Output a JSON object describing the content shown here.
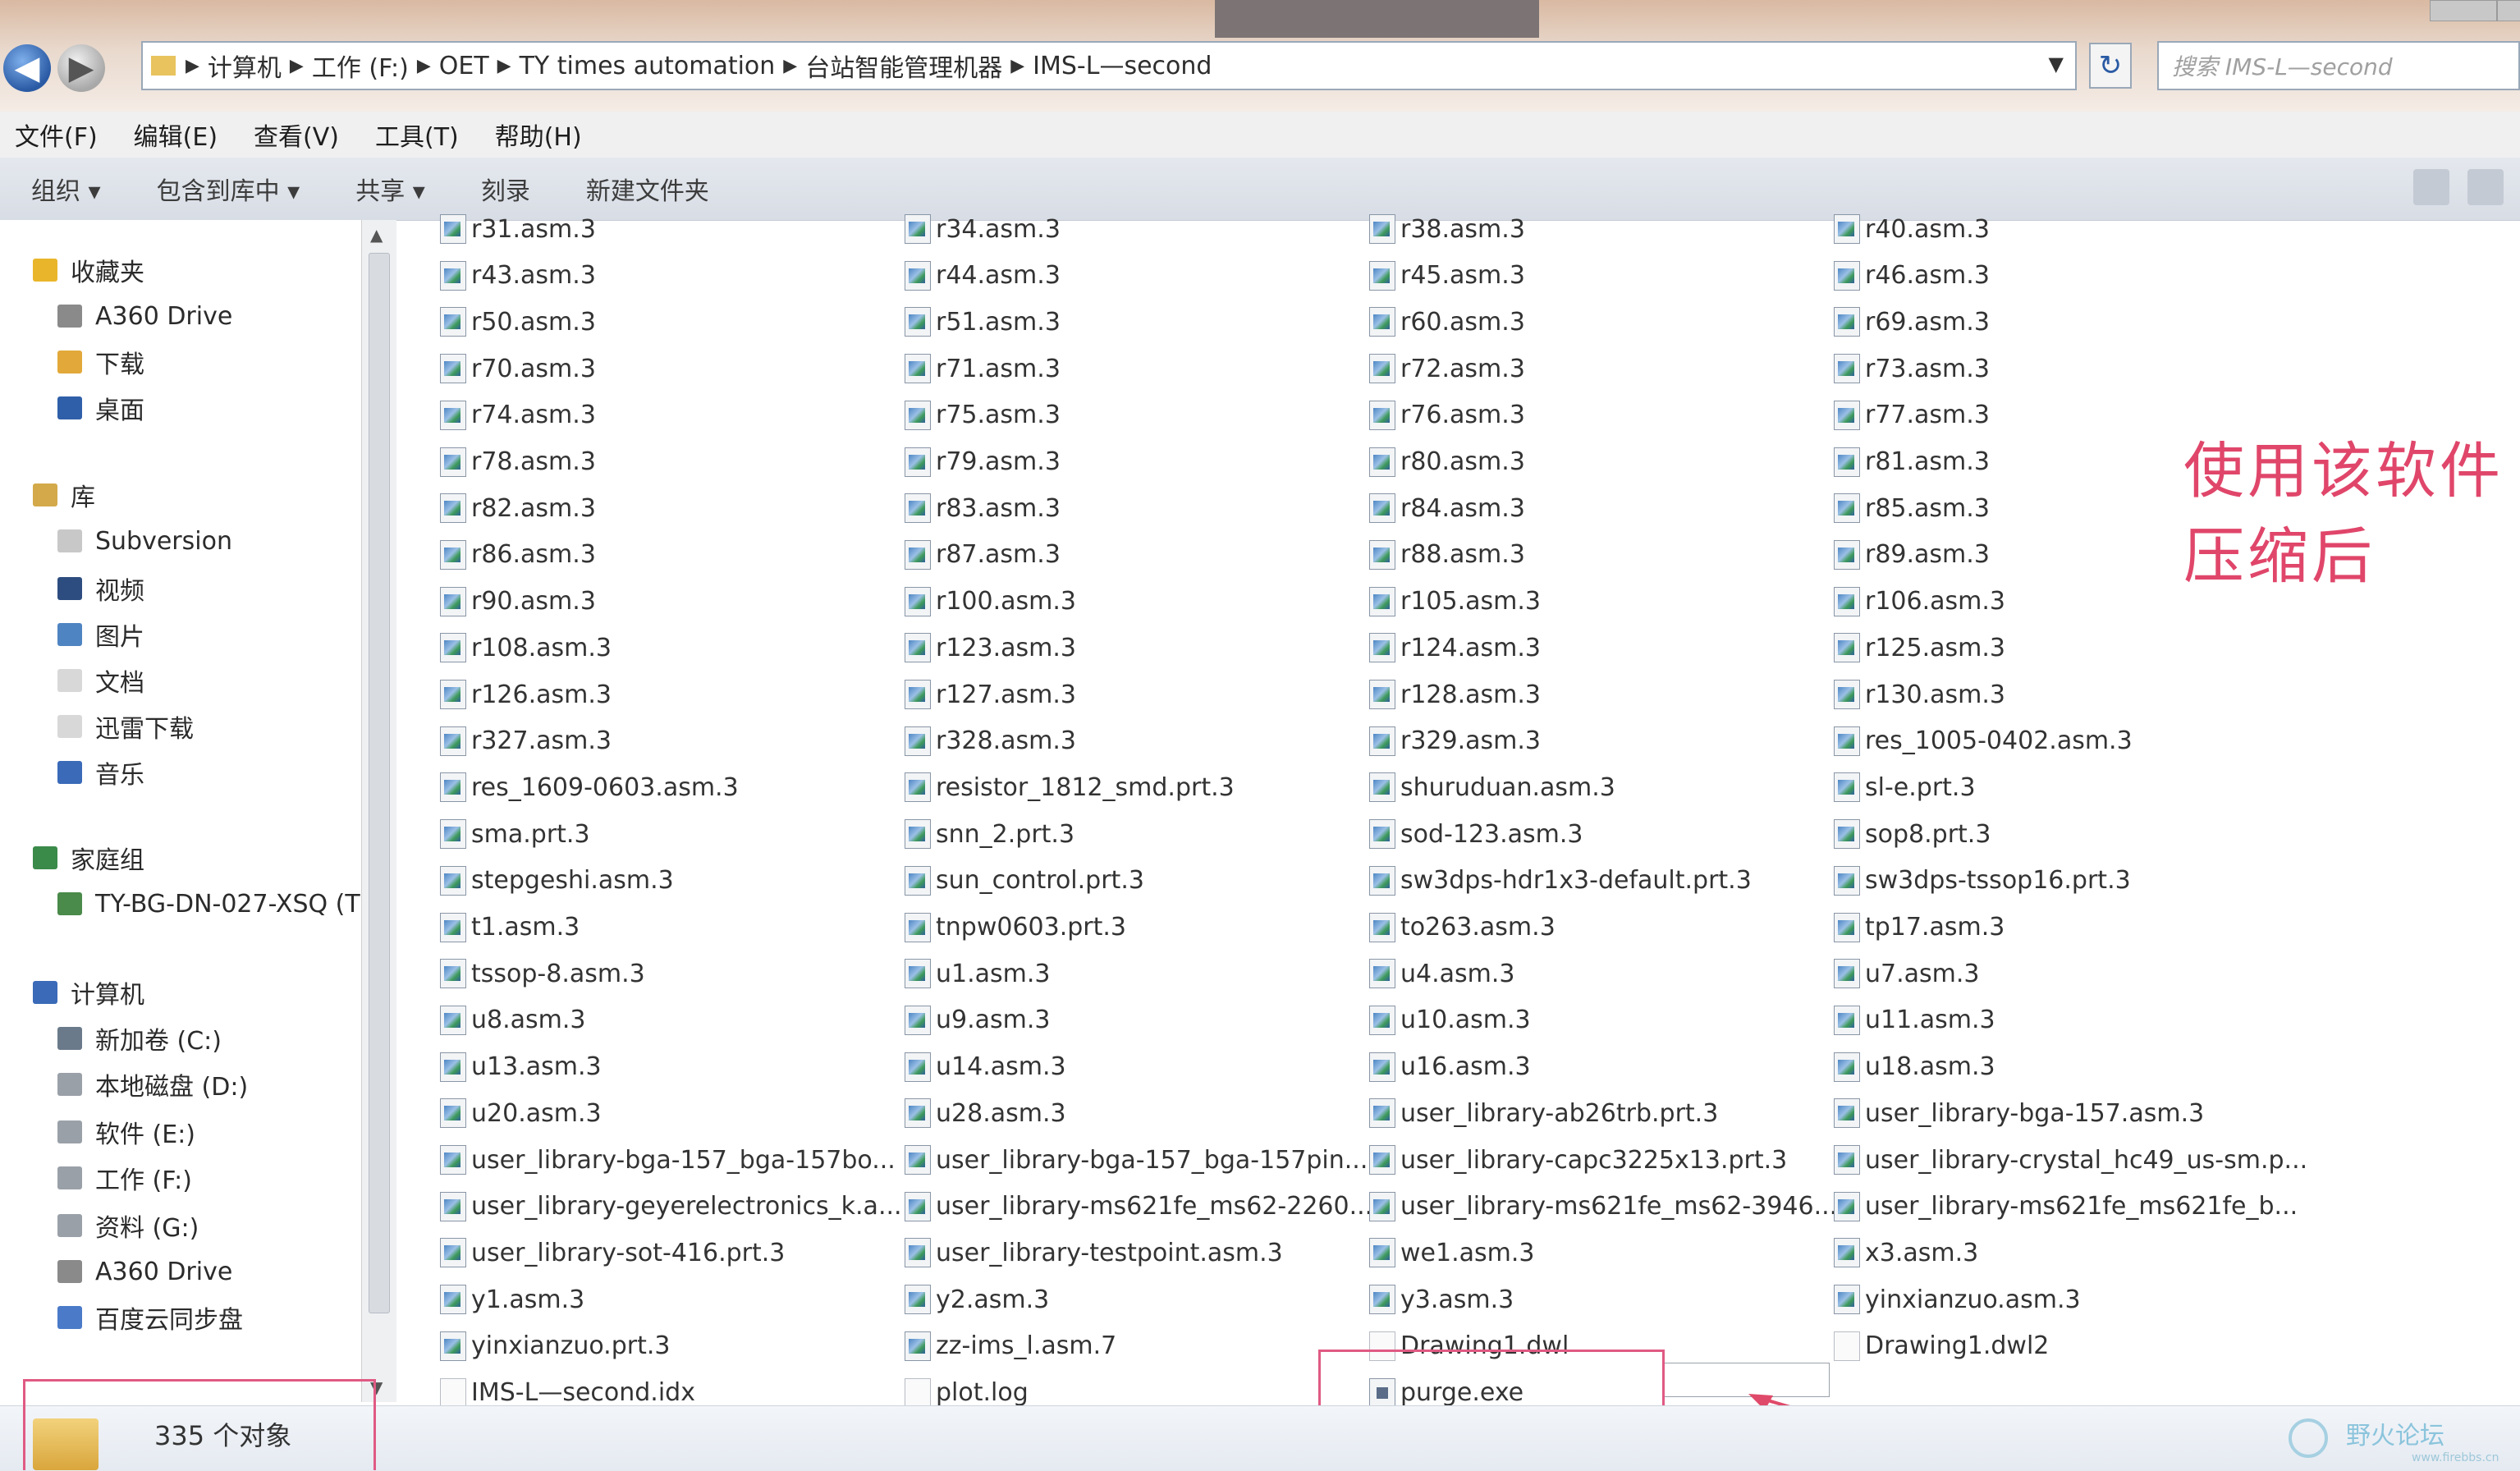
{
  "address": {
    "breadcrumbs": [
      "计算机",
      "工作 (F:)",
      "OET",
      "TY times automation",
      "台站智能管理机器",
      "IMS-L—second"
    ],
    "search_placeholder": "搜索 IMS-L—second"
  },
  "menu": [
    "文件(F)",
    "编辑(E)",
    "查看(V)",
    "工具(T)",
    "帮助(H)"
  ],
  "toolbar": [
    "组织 ▾",
    "包含到库中 ▾",
    "共享 ▾",
    "刻录",
    "新建文件夹"
  ],
  "sidebar": [
    {
      "label": "收藏夹",
      "icon": "star-icon",
      "color": "#e9b62b"
    },
    {
      "label": "A360 Drive",
      "icon": "cloud-drive-icon",
      "color": "#8a8a8a"
    },
    {
      "label": "下载",
      "icon": "download-folder-icon",
      "color": "#e2a93a"
    },
    {
      "label": "桌面",
      "icon": "desktop-icon",
      "color": "#2f5fa8"
    },
    {
      "label": "库",
      "icon": "library-icon",
      "color": "#d3a94a"
    },
    {
      "label": "Subversion",
      "icon": "folder-icon",
      "color": "#c8c8c8"
    },
    {
      "label": "视频",
      "icon": "video-icon",
      "color": "#2d4d80"
    },
    {
      "label": "图片",
      "icon": "pictures-icon",
      "color": "#4f84c2"
    },
    {
      "label": "文档",
      "icon": "documents-icon",
      "color": "#d8d8d8"
    },
    {
      "label": "迅雷下载",
      "icon": "folder-icon",
      "color": "#d8d8d8"
    },
    {
      "label": "音乐",
      "icon": "music-icon",
      "color": "#3a6ab8"
    },
    {
      "label": "家庭组",
      "icon": "homegroup-icon",
      "color": "#3a8a4a"
    },
    {
      "label": "TY-BG-DN-027-XSQ (T",
      "icon": "user-icon",
      "color": "#4a8a4a"
    },
    {
      "label": "计算机",
      "icon": "computer-icon",
      "color": "#3a6ab8"
    },
    {
      "label": "新加卷 (C:)",
      "icon": "drive-icon",
      "color": "#6a7a8a"
    },
    {
      "label": "本地磁盘 (D:)",
      "icon": "drive-icon",
      "color": "#9aa0a8"
    },
    {
      "label": "软件 (E:)",
      "icon": "drive-icon",
      "color": "#9aa0a8"
    },
    {
      "label": "工作 (F:)",
      "icon": "drive-icon",
      "color": "#9aa0a8"
    },
    {
      "label": "资料 (G:)",
      "icon": "drive-icon",
      "color": "#9aa0a8"
    },
    {
      "label": "A360 Drive",
      "icon": "cloud-drive-icon",
      "color": "#8a8a8a"
    },
    {
      "label": "百度云同步盘",
      "icon": "cloud-sync-icon",
      "color": "#4a7ac8"
    }
  ],
  "files": [
    [
      "r31.asm.3",
      "r34.asm.3",
      "r38.asm.3",
      "r40.asm.3"
    ],
    [
      "r43.asm.3",
      "r44.asm.3",
      "r45.asm.3",
      "r46.asm.3"
    ],
    [
      "r50.asm.3",
      "r51.asm.3",
      "r60.asm.3",
      "r69.asm.3"
    ],
    [
      "r70.asm.3",
      "r71.asm.3",
      "r72.asm.3",
      "r73.asm.3"
    ],
    [
      "r74.asm.3",
      "r75.asm.3",
      "r76.asm.3",
      "r77.asm.3"
    ],
    [
      "r78.asm.3",
      "r79.asm.3",
      "r80.asm.3",
      "r81.asm.3"
    ],
    [
      "r82.asm.3",
      "r83.asm.3",
      "r84.asm.3",
      "r85.asm.3"
    ],
    [
      "r86.asm.3",
      "r87.asm.3",
      "r88.asm.3",
      "r89.asm.3"
    ],
    [
      "r90.asm.3",
      "r100.asm.3",
      "r105.asm.3",
      "r106.asm.3"
    ],
    [
      "r108.asm.3",
      "r123.asm.3",
      "r124.asm.3",
      "r125.asm.3"
    ],
    [
      "r126.asm.3",
      "r127.asm.3",
      "r128.asm.3",
      "r130.asm.3"
    ],
    [
      "r327.asm.3",
      "r328.asm.3",
      "r329.asm.3",
      "res_1005-0402.asm.3"
    ],
    [
      "res_1609-0603.asm.3",
      "resistor_1812_smd.prt.3",
      "shuruduan.asm.3",
      "sl-e.prt.3"
    ],
    [
      "sma.prt.3",
      "snn_2.prt.3",
      "sod-123.asm.3",
      "sop8.prt.3"
    ],
    [
      "stepgeshi.asm.3",
      "sun_control.prt.3",
      "sw3dps-hdr1x3-default.prt.3",
      "sw3dps-tssop16.prt.3"
    ],
    [
      "t1.asm.3",
      "tnpw0603.prt.3",
      "to263.asm.3",
      "tp17.asm.3"
    ],
    [
      "tssop-8.asm.3",
      "u1.asm.3",
      "u4.asm.3",
      "u7.asm.3"
    ],
    [
      "u8.asm.3",
      "u9.asm.3",
      "u10.asm.3",
      "u11.asm.3"
    ],
    [
      "u13.asm.3",
      "u14.asm.3",
      "u16.asm.3",
      "u18.asm.3"
    ],
    [
      "u20.asm.3",
      "u28.asm.3",
      "user_library-ab26trb.prt.3",
      "user_library-bga-157.asm.3"
    ],
    [
      "user_library-bga-157_bga-157bo...",
      "user_library-bga-157_bga-157pin...",
      "user_library-capc3225x13.prt.3",
      "user_library-crystal_hc49_us-sm.p..."
    ],
    [
      "user_library-geyerelectronics_k.a...",
      "user_library-ms621fe_ms62-2260...",
      "user_library-ms621fe_ms62-3946...",
      "user_library-ms621fe_ms621fe_b..."
    ],
    [
      "user_library-sot-416.prt.3",
      "user_library-testpoint.asm.3",
      "we1.asm.3",
      "x3.asm.3"
    ],
    [
      "y1.asm.3",
      "y2.asm.3",
      "y3.asm.3",
      "yinxianzuo.asm.3"
    ],
    [
      "yinxianzuo.prt.3",
      "zz-ims_l.asm.7",
      "Drawing1.dwl",
      "Drawing1.dwl2"
    ],
    [
      "IMS-L—second.idx",
      "plot.log",
      "purge.exe",
      ""
    ]
  ],
  "annotation": {
    "line1": "使用该软件",
    "line2": "压缩后"
  },
  "status": {
    "count_text": "335 个对象"
  },
  "watermark": {
    "text": "野火论坛",
    "sub": "www.firebbs.cn"
  },
  "colors": {
    "annotation": "#e0466a",
    "highlight_box": "#e05a84",
    "arrow": "#e04a6a"
  }
}
